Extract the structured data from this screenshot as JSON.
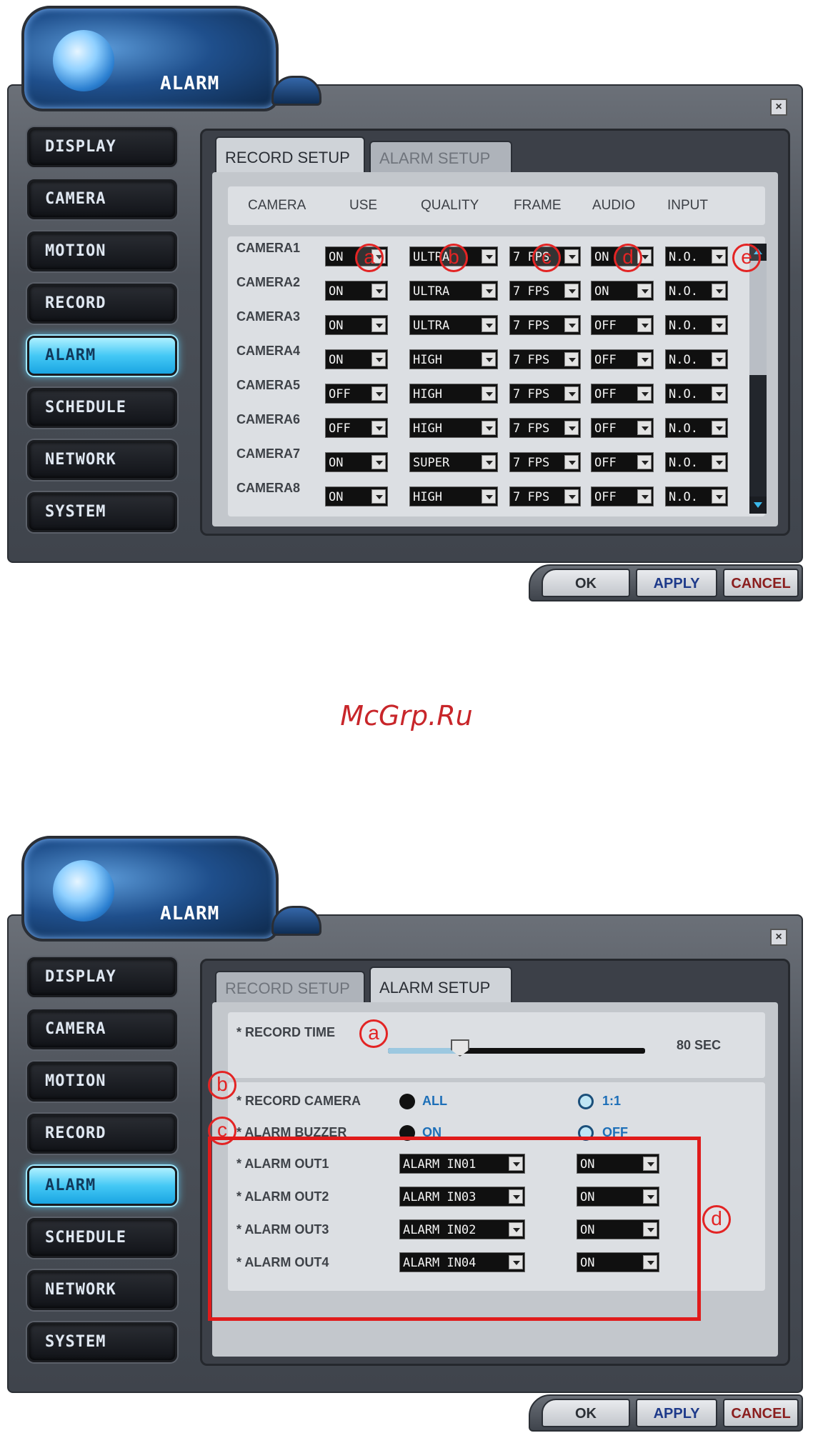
{
  "app_title": "ALARM",
  "watermark": "McGrp.Ru",
  "nav": [
    "DISPLAY",
    "CAMERA",
    "MOTION",
    "RECORD",
    "ALARM",
    "SCHEDULE",
    "NETWORK",
    "SYSTEM"
  ],
  "active_nav": "ALARM",
  "tabs": [
    "RECORD SETUP",
    "ALARM SETUP"
  ],
  "buttons": {
    "ok": "OK",
    "apply": "APPLY",
    "cancel": "CANCEL"
  },
  "record_setup": {
    "columns": [
      "CAMERA",
      "USE",
      "QUALITY",
      "FRAME",
      "AUDIO",
      "INPUT"
    ],
    "rows": [
      {
        "camera": "CAMERA1",
        "use": "ON",
        "quality": "ULTRA",
        "frame": "7 FPS",
        "audio": "ON",
        "input": "N.O."
      },
      {
        "camera": "CAMERA2",
        "use": "ON",
        "quality": "ULTRA",
        "frame": "7 FPS",
        "audio": "ON",
        "input": "N.O."
      },
      {
        "camera": "CAMERA3",
        "use": "ON",
        "quality": "ULTRA",
        "frame": "7 FPS",
        "audio": "OFF",
        "input": "N.O."
      },
      {
        "camera": "CAMERA4",
        "use": "ON",
        "quality": "HIGH",
        "frame": "7 FPS",
        "audio": "OFF",
        "input": "N.O."
      },
      {
        "camera": "CAMERA5",
        "use": "OFF",
        "quality": "HIGH",
        "frame": "7 FPS",
        "audio": "OFF",
        "input": "N.O."
      },
      {
        "camera": "CAMERA6",
        "use": "OFF",
        "quality": "HIGH",
        "frame": "7 FPS",
        "audio": "OFF",
        "input": "N.O."
      },
      {
        "camera": "CAMERA7",
        "use": "ON",
        "quality": "SUPER",
        "frame": "7 FPS",
        "audio": "OFF",
        "input": "N.O."
      },
      {
        "camera": "CAMERA8",
        "use": "ON",
        "quality": "HIGH",
        "frame": "7 FPS",
        "audio": "OFF",
        "input": "N.O."
      }
    ],
    "markers": [
      "a",
      "b",
      "c",
      "d",
      "e"
    ]
  },
  "alarm_setup": {
    "record_time": {
      "label": "* RECORD TIME",
      "value": "80 SEC",
      "fraction": 0.28
    },
    "record_camera": {
      "label": "* RECORD CAMERA",
      "options": [
        "ALL",
        "1:1"
      ],
      "selected": "ALL"
    },
    "alarm_buzzer": {
      "label": "* ALARM BUZZER",
      "options": [
        "ON",
        "OFF"
      ],
      "selected": "ON"
    },
    "alarm_outs": [
      {
        "label": "* ALARM OUT1",
        "input": "ALARM IN01",
        "state": "ON"
      },
      {
        "label": "* ALARM OUT2",
        "input": "ALARM IN03",
        "state": "ON"
      },
      {
        "label": "* ALARM OUT3",
        "input": "ALARM IN02",
        "state": "ON"
      },
      {
        "label": "* ALARM OUT4",
        "input": "ALARM IN04",
        "state": "ON"
      }
    ],
    "markers": [
      "a",
      "b",
      "c",
      "d"
    ]
  },
  "colors": {
    "accent": "#44c8f5",
    "marker": "#e32424",
    "frame": "#4b5058"
  }
}
